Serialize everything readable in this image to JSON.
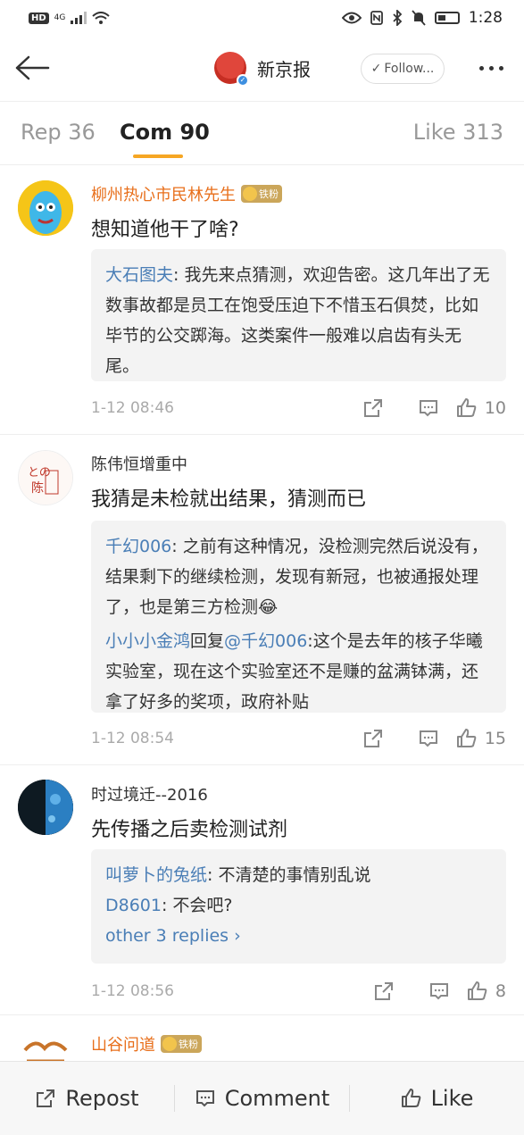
{
  "status_bar": {
    "left_badge": "HD",
    "network": "4G",
    "time": "1:28"
  },
  "header": {
    "title": "新京报",
    "follow_label": "Follow..."
  },
  "tabs": {
    "repost": "Rep 36",
    "comment": "Com 90",
    "like": "Like 313"
  },
  "comments": [
    {
      "user": "柳州热心市民林先生",
      "badge": "铁粉",
      "text": "想知道他干了啥?",
      "replies": [
        {
          "author": "大石图夫",
          "text": ": 我先来点猜测，欢迎告密。这几年出了无数事故都是员工在饱受压迫下不惜玉石俱焚，比如毕节的公交踯海。这类案件一般难以启齿有头无尾。"
        }
      ],
      "time": "1-12 08:46",
      "likes": "10"
    },
    {
      "user": "陈伟恒增重中",
      "text": "我猜是未检就出结果，猜测而已",
      "replies": [
        {
          "author": "千幻006",
          "text": ": 之前有这种情况，没检测完然后说没有，结果剩下的继续检测，发现有新冠，也被通报处理了，也是第三方检测😂"
        },
        {
          "author": "小小小金鸿",
          "mid": "回复",
          "mention": "@千幻006",
          "text": ":这个是去年的核子华曦实验室，现在这个实验室还不是赚的盆满钵满，还拿了好多的奖项，政府补贴"
        }
      ],
      "time": "1-12 08:54",
      "likes": "15"
    },
    {
      "user": "时过境迁--2016",
      "text": "先传播之后卖检测试剂",
      "replies": [
        {
          "author": "叫萝卜的兔纸",
          "text": ": 不清楚的事情别乱说"
        },
        {
          "author": "D8601",
          "text": ": 不会吧?"
        }
      ],
      "more_replies": "other 3 replies ›",
      "time": "1-12 08:56",
      "likes": "8"
    },
    {
      "user": "山谷问道",
      "badge": "铁粉"
    }
  ],
  "bottom_bar": {
    "repost": "Repost",
    "comment": "Comment",
    "like": "Like"
  },
  "colors": {
    "accent": "#f6a623",
    "username_orange": "#e86f1b",
    "link_blue": "#4a7eb6"
  }
}
